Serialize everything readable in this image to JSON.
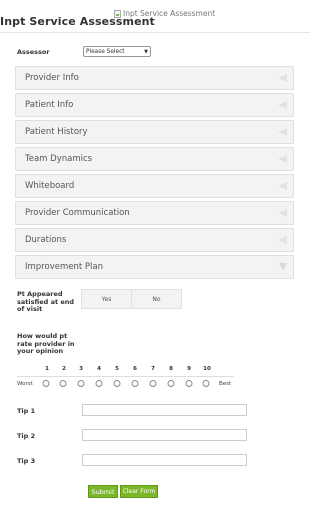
{
  "header": {
    "image_alt": "Inpt Service Assessment",
    "title": "Inpt Service Assessment"
  },
  "assessor": {
    "label": "Assessor",
    "selected": "Please Select"
  },
  "sections": [
    {
      "label": "Provider Info",
      "state": "collapsed"
    },
    {
      "label": "Patient Info",
      "state": "collapsed"
    },
    {
      "label": "Patient History",
      "state": "collapsed"
    },
    {
      "label": "Team Dynamics",
      "state": "collapsed"
    },
    {
      "label": "Whiteboard",
      "state": "collapsed"
    },
    {
      "label": "Provider Communication",
      "state": "collapsed"
    },
    {
      "label": "Durations",
      "state": "collapsed"
    },
    {
      "label": "Improvement Plan",
      "state": "expanded"
    }
  ],
  "satisfied": {
    "label": "Pt Appeared satisfied at end of visit",
    "yes": "Yes",
    "no": "No"
  },
  "rating": {
    "label": "How would pt rate provider in your opinion",
    "scale": [
      "1",
      "2",
      "3",
      "4",
      "5",
      "6",
      "7",
      "8",
      "9",
      "10"
    ],
    "low": "Worst",
    "high": "Best"
  },
  "tips": [
    {
      "label": "Tip 1",
      "value": ""
    },
    {
      "label": "Tip 2",
      "value": ""
    },
    {
      "label": "Tip 3",
      "value": ""
    }
  ],
  "actions": {
    "submit": "Submit",
    "clear": "Clear Form"
  }
}
